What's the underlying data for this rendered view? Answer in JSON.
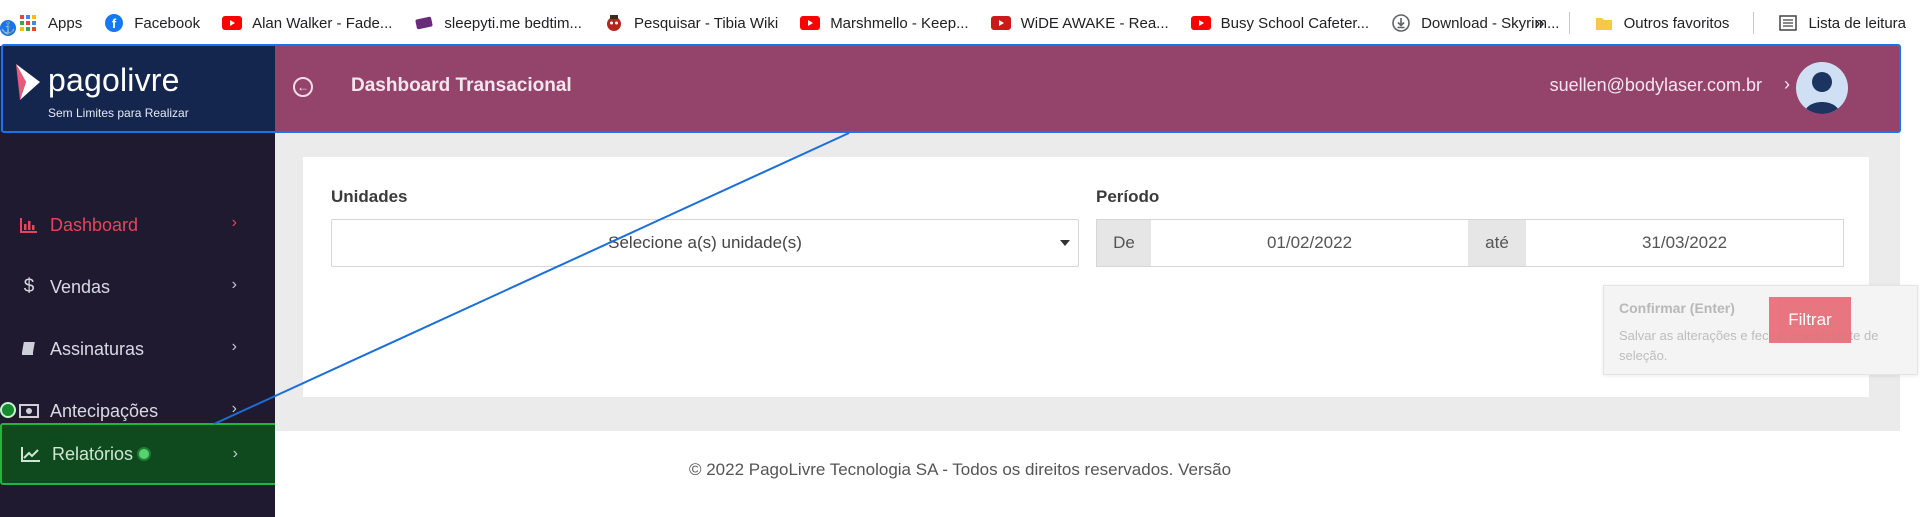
{
  "bookmarks": {
    "items": [
      {
        "label": "Apps",
        "icon": "apps-grid-icon"
      },
      {
        "label": "Facebook",
        "icon": "facebook-icon"
      },
      {
        "label": "Alan Walker - Fade...",
        "icon": "youtube-icon"
      },
      {
        "label": "sleepyti.me bedtim...",
        "icon": "sleepytime-icon"
      },
      {
        "label": "Pesquisar - Tibia Wiki",
        "icon": "tibia-icon"
      },
      {
        "label": "Marshmello - Keep...",
        "icon": "youtube-icon"
      },
      {
        "label": "WiDE AWAKE - Rea...",
        "icon": "youtube-icon"
      },
      {
        "label": "Busy School Cafeter...",
        "icon": "youtube-icon"
      },
      {
        "label": "Download - Skyrim...",
        "icon": "download-icon"
      }
    ],
    "overflow": "»",
    "other_favorites": "Outros favoritos",
    "reading_list": "Lista de leitura"
  },
  "brand": {
    "name": "pagolivre",
    "tagline": "Sem Limites para Realizar"
  },
  "sidebar": {
    "items": [
      {
        "label": "Dashboard",
        "icon": "bar-chart-icon",
        "active": true
      },
      {
        "label": "Vendas",
        "icon": "dollar-icon"
      },
      {
        "label": "Assinaturas",
        "icon": "book-icon"
      },
      {
        "label": "Antecipações",
        "icon": "money-icon"
      },
      {
        "label": "Relatórios",
        "icon": "line-chart-icon"
      }
    ]
  },
  "header": {
    "title": "Dashboard Transacional",
    "user_email": "suellen@bodylaser.com.br"
  },
  "filters": {
    "units_label": "Unidades",
    "units_placeholder": "Selecione a(s) unidade(s)",
    "period_label": "Período",
    "from_label": "De",
    "from_date": "01/02/2022",
    "to_label": "até",
    "to_date": "31/03/2022",
    "filter_button": "Filtrar"
  },
  "tooltip": {
    "title": "Confirmar (Enter)",
    "body": "Salvar as alterações e fechar o assistente de seleção."
  },
  "footer": {
    "text": "© 2022 PagoLivre Tecnologia SA - Todos os direitos reservados. Versão"
  },
  "colors": {
    "header_bg": "#94446b",
    "sidebar_bg": "#1f1a30",
    "logo_bg": "#14264e",
    "active_item": "#e7455a",
    "filter_button": "#e8707b",
    "selection_outline": "#1a73e8",
    "highlight_green": "#1fb63a"
  }
}
